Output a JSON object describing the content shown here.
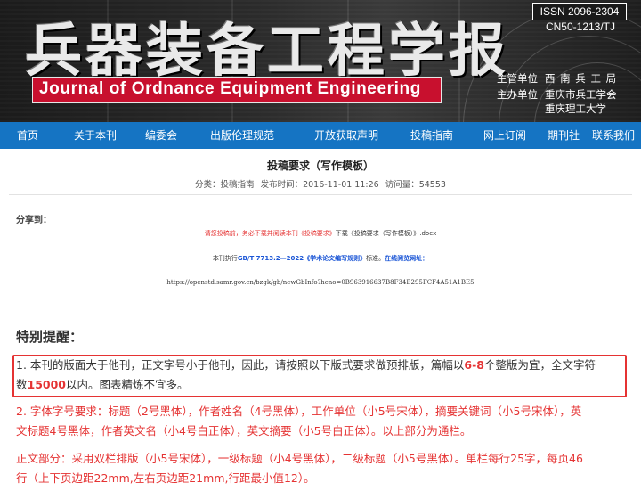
{
  "banner": {
    "cn_title": "兵器装备工程学报",
    "en_title": "Journal of Ordnance  Equipment  Engineering",
    "issn": "ISSN 2096-2304",
    "cn_number": "CN50-1213/TJ",
    "sponsor_label": "主管单位",
    "sponsor": "西 南 兵 工 局",
    "organizer_label": "主办单位",
    "organizer_1": "重庆市兵工学会",
    "organizer_2": "重庆理工大学"
  },
  "nav": {
    "items": [
      "首页",
      "关于本刊",
      "编委会",
      "出版伦理规范",
      "开放获取声明",
      "投稿指南",
      "网上订阅",
      "期刊社",
      "联系我们"
    ],
    "color": "#1574c3"
  },
  "article": {
    "title": "投稿要求（写作模板）",
    "category": "分类：投稿指南",
    "publish_time": "发布时间：2016-11-01 11:26",
    "views": "访问量：54553",
    "share_label": "分享到：",
    "notice_red": "请您投稿前，务必下载并阅读本刊《投稿要求》",
    "notice_dark": "下载《投稿要求（写作模板）》.docx",
    "std_prefix": "本刊执行",
    "std_name": "GB/T 7713.2—2022《学术论文编写规则》",
    "std_mid": "标准。",
    "std_online": "在线阅览网址：",
    "std_url": "https://openstd.samr.gov.cn/bzgk/gb/newGbInfo?hcno=0B963916637B8F34B295FCF4A51A1BE5",
    "reminder_heading": "特别提醒：",
    "p1_line1_a": "1. 本刊的版面大于他刊，正文字号小于他刊，因此，请按照以下版式要求做预排版，篇幅以",
    "p1_range": "6-8",
    "p1_line1_b": "个整版为宜，全文字符",
    "p1_line2_a": "数",
    "p1_count": "15000",
    "p1_line2_b": "以内。图表精炼不宜多。",
    "p2_line1": "2. 字体字号要求：标题（2号黑体），作者姓名（4号黑体），工作单位（小5号宋体），摘要关键词（小5号宋体），英",
    "p2_line2": "文标题4号黑体，作者英文名（小4号白正体），英文摘要（小5号白正体）。以上部分为通栏。",
    "p3_line1": "正文部分：采用双栏排版（小5号宋体），一级标题（小4号黑体），二级标题（小5号黑体）。单栏每行25字，每页46",
    "p3_line2": "行（上下页边距22mm,左右页边距21mm,行距最小值12）。"
  },
  "colors": {
    "accent_red": "#e53333",
    "brand_red": "#c8102e",
    "link_blue": "#1a55d6"
  }
}
